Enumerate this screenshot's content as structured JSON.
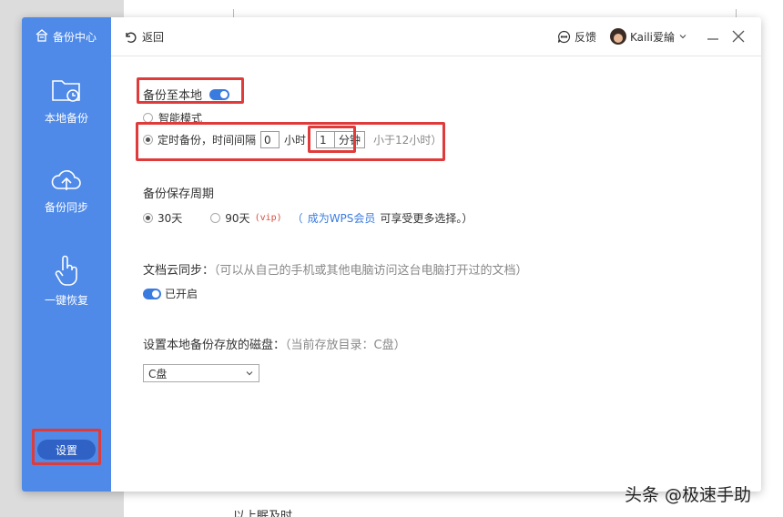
{
  "sidebar": {
    "title": "备份中心",
    "items": [
      {
        "label": "本地备份"
      },
      {
        "label": "备份同步"
      },
      {
        "label": "一键恢复"
      }
    ],
    "settings_label": "设置"
  },
  "titlebar": {
    "back_label": "返回",
    "feedback_label": "反馈",
    "user_name": "Kaili爱綸"
  },
  "local_backup": {
    "title": "备份至本地",
    "enabled": true,
    "smart_mode_label": "智能模式",
    "timed_label": "定时备份，时间间隔",
    "hours_value": "0",
    "hours_unit": "小时",
    "minutes_value": "1",
    "minutes_unit": "分钟",
    "hint": "小于12小时）"
  },
  "retention": {
    "title": "备份保存周期",
    "option_30": "30天",
    "option_90": "90天",
    "vip_tag": "(vip)",
    "paren_open": "（",
    "member_link": "成为WPS会员",
    "member_tail": "可享受更多选择。）"
  },
  "cloud_sync": {
    "title": "文档云同步：",
    "desc": "（可以从自己的手机或其他电脑访问这台电脑打开过的文档）",
    "status": "已开启"
  },
  "disk": {
    "title": "设置本地备份存放的磁盘：",
    "current": "（当前存放目录：C盘）",
    "selected": "C盘"
  },
  "background": {
    "footer_text": "以上眠及时"
  },
  "watermark": "头条 @极速手助",
  "colors": {
    "sidebar_bg": "#4f8ae8",
    "accent": "#3a7be0",
    "highlight": "#e03b3b"
  }
}
